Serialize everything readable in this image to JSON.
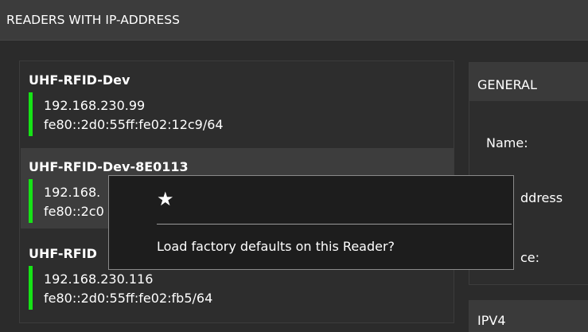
{
  "window": {
    "title": "READERS WITH IP-ADDRESS"
  },
  "readers": [
    {
      "name": "UHF-RFID-Dev",
      "ipv4": "192.168.230.99",
      "ipv6": "fe80::2d0:55ff:fe02:12c9/64",
      "status": "online",
      "selected": false
    },
    {
      "name": "UHF-RFID-Dev-8E0113",
      "ipv4": "192.168.",
      "ipv6": "fe80::2c0",
      "status": "online",
      "selected": true
    },
    {
      "name": "UHF-RFID",
      "ipv4": "192.168.230.116",
      "ipv6": "fe80::2d0:55ff:fe02:fb5/64",
      "status": "online",
      "selected": false
    }
  ],
  "general": {
    "title": "GENERAL",
    "labels": {
      "name": "Name:",
      "address": "ddress",
      "device": "ce:"
    }
  },
  "ipv4_section": {
    "title": "IPV4"
  },
  "dialog": {
    "icon": "star-icon",
    "icon_glyph": "★",
    "message": "Load factory defaults on this Reader?"
  },
  "colors": {
    "status_online": "#16e316",
    "background": "#2b2b2b",
    "selected_row": "#3d3d3d",
    "dialog_background": "#1d1d1d"
  }
}
